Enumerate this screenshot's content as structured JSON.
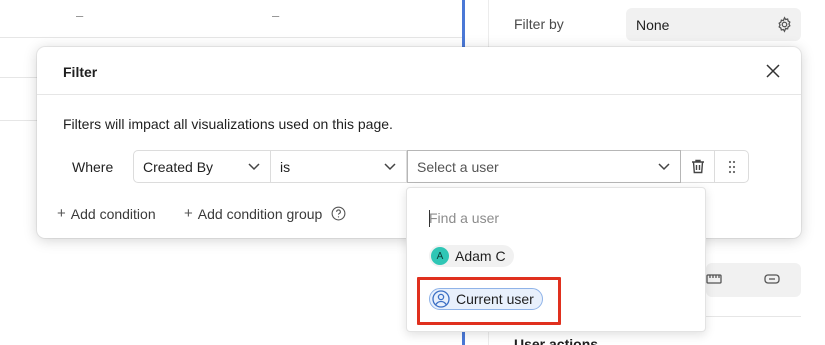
{
  "background": {
    "dashes": [
      "–",
      "–"
    ],
    "filter_by_label": "Filter by",
    "filter_by_value": "None",
    "user_actions_label": "User actions"
  },
  "modal": {
    "title": "Filter",
    "description": "Filters will impact all visualizations used on this page.",
    "where_label": "Where",
    "field_value": "Created By",
    "operator_value": "is",
    "user_select_placeholder": "Select a user",
    "add_condition_label": "Add condition",
    "add_condition_group_label": "Add condition group"
  },
  "dropdown": {
    "search_placeholder": "Find a user",
    "options": [
      {
        "initial": "A",
        "label": "Adam C"
      },
      {
        "label": "Current user"
      }
    ]
  },
  "colors": {
    "accent": "#4a78d6",
    "highlight": "#e0301e",
    "avatar": "#2fc6b5"
  },
  "icons": [
    "gear-icon",
    "close-icon",
    "chevron-down-icon",
    "trash-icon",
    "drag-handle-icon",
    "help-icon",
    "user-icon"
  ]
}
